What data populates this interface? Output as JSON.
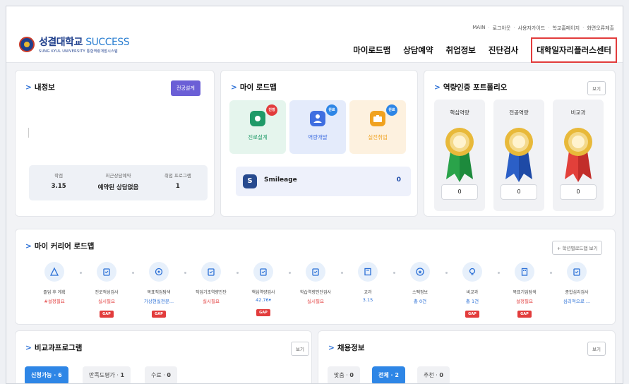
{
  "header": {
    "toplinks": [
      "MAIN",
      "로그아웃",
      "사용자가이드",
      "학교홈페이지",
      "화면오류제출"
    ],
    "logo_main": "성결대학교",
    "logo_success": "SUCCESS",
    "logo_sub": "SUNG KYUL UNIVERSITY  통합역량개발시스템",
    "nav": [
      "마이로드맵",
      "상담예약",
      "취업정보",
      "진단검사",
      "대학일자리플러스센터"
    ]
  },
  "myinfo": {
    "title": "내정보",
    "button": "전공설계",
    "stats": [
      {
        "label": "학점",
        "value": "3.15"
      },
      {
        "label": "최근상담예약",
        "value": "예약된 상담없음"
      },
      {
        "label": "취업 프로그램",
        "value": "1"
      }
    ]
  },
  "roadmap": {
    "title": "마이 로드맵",
    "tiles": [
      {
        "label": "진로설계",
        "badge": "진행"
      },
      {
        "label": "역량개발",
        "badge": "완료"
      },
      {
        "label": "실전취업",
        "badge": "완료"
      }
    ],
    "smileage_label": "Smileage",
    "smileage_value": "0"
  },
  "portfolio": {
    "title": "역량인증 포트폴리오",
    "see": "보기",
    "cols": [
      {
        "label": "핵심역량",
        "value": "0"
      },
      {
        "label": "전공역량",
        "value": "0"
      },
      {
        "label": "비교과",
        "value": "0"
      }
    ]
  },
  "career": {
    "title": "마이 커리어 로드맵",
    "button": "+ 학년별로드맵 보기",
    "steps": [
      {
        "name": "졸업 후 계획",
        "value": "#설정필요",
        "gap": ""
      },
      {
        "name": "진로적성검사",
        "value": "실시필요",
        "gap": "GAP"
      },
      {
        "name": "목표직업탐색",
        "value": "가상현실전문...",
        "gap": "GAP"
      },
      {
        "name": "직업기초역량진단",
        "value": "실시필요",
        "gap": ""
      },
      {
        "name": "핵심역량검사",
        "value": "42.76▾",
        "gap": "GAP"
      },
      {
        "name": "학습역량진단검사",
        "value": "실시필요",
        "gap": ""
      },
      {
        "name": "교과",
        "value": "3.15",
        "gap": ""
      },
      {
        "name": "스펙정보",
        "value": "총 0건",
        "gap": ""
      },
      {
        "name": "비교과",
        "value": "총 1건",
        "gap": "GAP"
      },
      {
        "name": "목표기업탐색",
        "value": "설정필요",
        "gap": "GAP"
      },
      {
        "name": "종합심리검사",
        "value": "심리적으로 ...",
        "gap": ""
      }
    ]
  },
  "extra": {
    "title": "비교과프로그램",
    "see": "보기",
    "pills": [
      {
        "label": "신청가능",
        "count": "6"
      },
      {
        "label": "만족도평가",
        "count": "1"
      },
      {
        "label": "수료",
        "count": "0"
      }
    ]
  },
  "jobs": {
    "title": "채용정보",
    "see": "보기",
    "pills": [
      {
        "label": "맞춤",
        "count": "0"
      },
      {
        "label": "전체",
        "count": "2"
      },
      {
        "label": "추천",
        "count": "0"
      }
    ]
  },
  "colors": {
    "accent": "#2e86e6",
    "gap": "#e23c3c",
    "purple": "#6b5fd6"
  }
}
